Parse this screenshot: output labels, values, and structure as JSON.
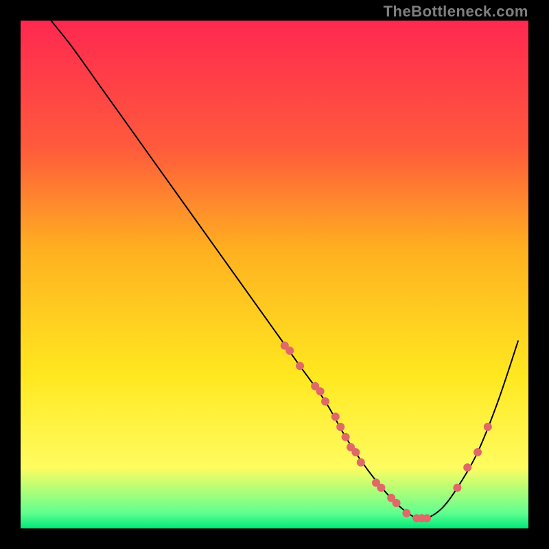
{
  "watermark": "TheBottleneck.com",
  "chart_data": {
    "type": "line",
    "title": "",
    "xlabel": "",
    "ylabel": "",
    "xlim": [
      0,
      100
    ],
    "ylim": [
      0,
      100
    ],
    "background_gradient": {
      "stops": [
        {
          "offset": 0.0,
          "color": "#ff2850"
        },
        {
          "offset": 0.25,
          "color": "#ff5a3c"
        },
        {
          "offset": 0.45,
          "color": "#ffb020"
        },
        {
          "offset": 0.7,
          "color": "#ffe820"
        },
        {
          "offset": 0.88,
          "color": "#fffc60"
        },
        {
          "offset": 0.97,
          "color": "#60ff90"
        },
        {
          "offset": 1.0,
          "color": "#00e878"
        }
      ]
    },
    "series": [
      {
        "name": "curve",
        "type": "line",
        "color": "#000000",
        "x": [
          6,
          10,
          15,
          20,
          25,
          30,
          35,
          40,
          45,
          50,
          55,
          60,
          64,
          68,
          72,
          75,
          78,
          80,
          83,
          86,
          90,
          94,
          98
        ],
        "y": [
          100,
          95,
          88,
          81,
          74,
          67,
          60,
          53,
          46,
          39,
          32,
          25,
          18,
          12,
          7,
          4,
          2,
          2,
          4,
          8,
          15,
          25,
          37
        ]
      },
      {
        "name": "markers",
        "type": "scatter",
        "color": "#e06868",
        "x": [
          52,
          53,
          55,
          58,
          59,
          60,
          62,
          63,
          64,
          65,
          66,
          67,
          70,
          71,
          73,
          74,
          76,
          78,
          79,
          80,
          86,
          88,
          90,
          92
        ],
        "y": [
          36,
          35,
          32,
          28,
          27,
          25,
          22,
          20,
          18,
          16,
          15,
          13,
          9,
          8,
          6,
          5,
          3,
          2,
          2,
          2,
          8,
          12,
          15,
          20
        ]
      }
    ]
  }
}
